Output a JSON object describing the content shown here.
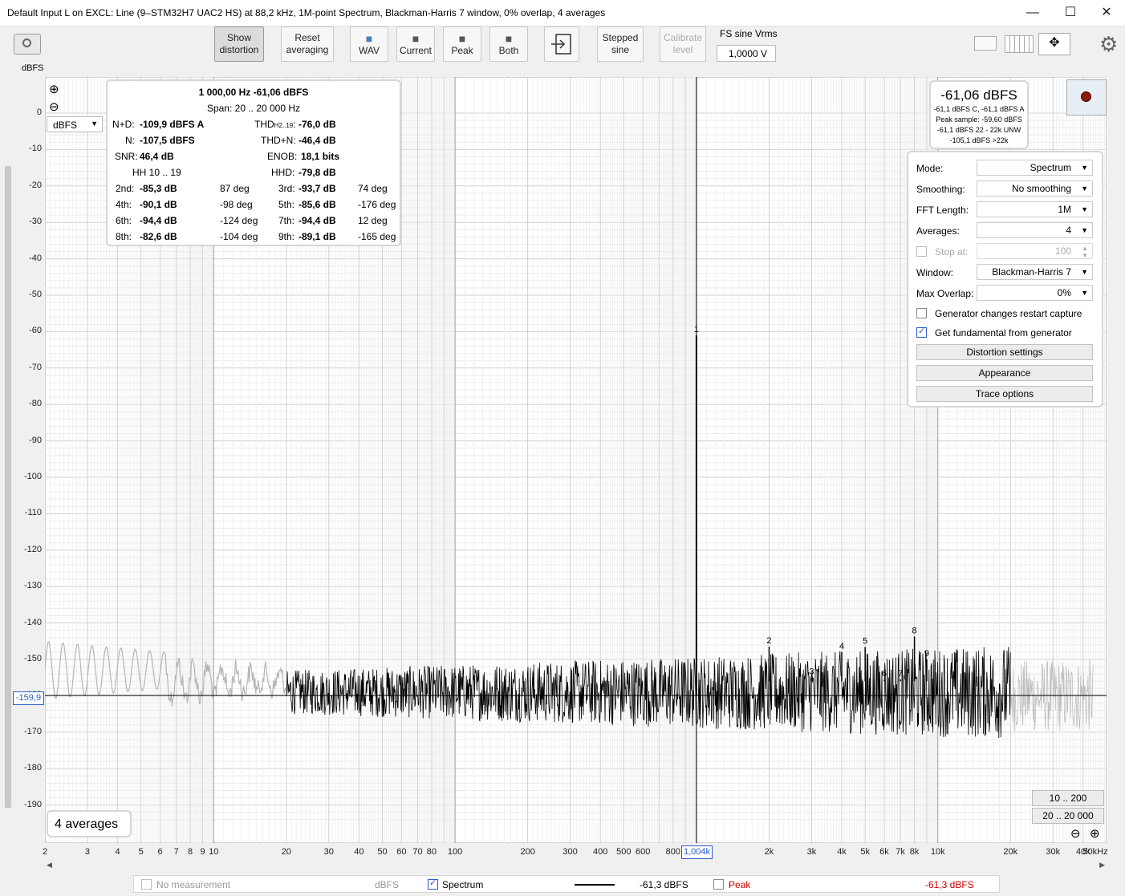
{
  "window": {
    "title": "Default Input L on EXCL: Line (9–STM32H7 UAC2 HS) at 88,2 kHz, 1M-point Spectrum, Blackman-Harris 7 window, 0% overlap, 4 averages",
    "minimize": "—",
    "maximize": "☐",
    "close": "✕"
  },
  "toolbar": {
    "show_distortion": [
      "Show",
      "distortion"
    ],
    "reset_averaging": [
      "Reset",
      "averaging"
    ],
    "wav": "WAV",
    "current": "Current",
    "peak": "Peak",
    "both": "Both",
    "stepped_sine": [
      "Stepped",
      "sine"
    ],
    "calibrate_level": [
      "Calibrate",
      "level"
    ],
    "fs_sine_label": "FS sine Vrms",
    "fs_sine_value": "1,0000 V"
  },
  "plot": {
    "y_unit": "dBFS",
    "unit_select": "dBFS",
    "cursor_value": "-159,9",
    "cursor_freq": "1,004k",
    "averages_badge": "4 averages",
    "range_btn_1": "10 .. 200",
    "range_btn_2": "20 .. 20 000",
    "zoom_in": "⊕",
    "zoom_out": "⊖"
  },
  "stats": {
    "header": "1 000,00 Hz  -61,06 dBFS",
    "span": "Span: 20 .. 20 000 Hz",
    "nd_label": "N+D:",
    "nd_value": "-109,9 dBFS A",
    "thd_label": "THD",
    "thd_sub": "H2..19",
    "thd_value": "-76,0 dB",
    "n_label": "N:",
    "n_value": "-107,5 dBFS",
    "thdn_label": "THD+N:",
    "thdn_value": "-46,4 dB",
    "snr_label": "SNR:",
    "snr_value": "46,4 dB",
    "enob_label": "ENOB:",
    "enob_value": "18,1 bits",
    "hh_label": "HH 10 .. 19",
    "hhd_label": "HHD:",
    "hhd_value": "-79,8 dB",
    "harmonics": [
      {
        "l1": "2nd:",
        "v1": "-85,3 dB",
        "p1": "87 deg",
        "l2": "3rd:",
        "v2": "-93,7 dB",
        "p2": "74 deg"
      },
      {
        "l1": "4th:",
        "v1": "-90,1 dB",
        "p1": "-98 deg",
        "l2": "5th:",
        "v2": "-85,6 dB",
        "p2": "-176 deg"
      },
      {
        "l1": "6th:",
        "v1": "-94,4 dB",
        "p1": "-124 deg",
        "l2": "7th:",
        "v2": "-94,4 dB",
        "p2": "12 deg"
      },
      {
        "l1": "8th:",
        "v1": "-82,6 dB",
        "p1": "-104 deg",
        "l2": "9th:",
        "v2": "-89,1 dB",
        "p2": "-165 deg"
      }
    ]
  },
  "level_box": {
    "main": "-61,06 dBFS",
    "line1": "-61,1 dBFS C, -61,1 dBFS A",
    "line2": "Peak sample: -59,60 dBFS",
    "line3": "-61,1 dBFS 22 - 22k UNW",
    "line4": "-105,1 dBFS >22k"
  },
  "controls": {
    "mode_label": "Mode:",
    "mode_value": "Spectrum",
    "smoothing_label": "Smoothing:",
    "smoothing_value": "No smoothing",
    "fft_label": "FFT Length:",
    "fft_value": "1M",
    "averages_label": "Averages:",
    "averages_value": "4",
    "stop_label": "Stop at:",
    "stop_value": "100",
    "window_label": "Window:",
    "window_value": "Blackman-Harris 7",
    "overlap_label": "Max Overlap:",
    "overlap_value": "0%",
    "gen_restart": "Generator changes restart capture",
    "gen_fundamental": "Get fundamental from generator",
    "distortion_settings": "Distortion settings",
    "appearance": "Appearance",
    "trace_options": "Trace options"
  },
  "status": {
    "no_measurement": "No measurement",
    "no_meas_unit": "dBFS",
    "spectrum": "Spectrum",
    "spectrum_value": "-61,3 dBFS",
    "peak": "Peak",
    "peak_value": "-61,3 dBFS"
  },
  "chart_data": {
    "type": "line",
    "ylabel": "dBFS",
    "xscale": "log",
    "ylim": [
      -195,
      0
    ],
    "xlim": [
      2,
      50000
    ],
    "y_ticks": [
      "0",
      "-10",
      "-20",
      "-30",
      "-40",
      "-50",
      "-60",
      "-70",
      "-80",
      "-90",
      "-100",
      "-110",
      "-120",
      "-130",
      "-140",
      "-150",
      "-160",
      "-170",
      "-180",
      "-190"
    ],
    "x_ticks": [
      {
        "v": 2,
        "t": "2"
      },
      {
        "v": 3,
        "t": "3"
      },
      {
        "v": 4,
        "t": "4"
      },
      {
        "v": 5,
        "t": "5"
      },
      {
        "v": 6,
        "t": "6"
      },
      {
        "v": 7,
        "t": "7"
      },
      {
        "v": 8,
        "t": "8"
      },
      {
        "v": 9,
        "t": "9"
      },
      {
        "v": 10,
        "t": "10"
      },
      {
        "v": 20,
        "t": "20"
      },
      {
        "v": 30,
        "t": "30"
      },
      {
        "v": 40,
        "t": "40"
      },
      {
        "v": 50,
        "t": "50"
      },
      {
        "v": 60,
        "t": "60"
      },
      {
        "v": 70,
        "t": "70"
      },
      {
        "v": 80,
        "t": "80"
      },
      {
        "v": 100,
        "t": "100"
      },
      {
        "v": 200,
        "t": "200"
      },
      {
        "v": 300,
        "t": "300"
      },
      {
        "v": 400,
        "t": "400"
      },
      {
        "v": 500,
        "t": "500"
      },
      {
        "v": 600,
        "t": "600"
      },
      {
        "v": 800,
        "t": "800"
      },
      {
        "v": 2000,
        "t": "2k"
      },
      {
        "v": 3000,
        "t": "3k"
      },
      {
        "v": 4000,
        "t": "4k"
      },
      {
        "v": 5000,
        "t": "5k"
      },
      {
        "v": 6000,
        "t": "6k"
      },
      {
        "v": 7000,
        "t": "7k"
      },
      {
        "v": 8000,
        "t": "8k"
      },
      {
        "v": 10000,
        "t": "10k"
      },
      {
        "v": 20000,
        "t": "20k"
      },
      {
        "v": 30000,
        "t": "30k"
      },
      {
        "v": 40000,
        "t": "40k"
      },
      {
        "v": 50000,
        "t": "50kHz"
      }
    ],
    "cursor_db": -159.9,
    "fundamental": {
      "freq": 1000,
      "db": -61.06
    },
    "noise_floor_db": -160,
    "harmonics": [
      {
        "n": "1",
        "freq": 1000,
        "db": -61
      },
      {
        "n": "2",
        "freq": 2000,
        "db": -146.5
      },
      {
        "n": "3",
        "freq": 3000,
        "db": -155
      },
      {
        "n": "4",
        "freq": 4000,
        "db": -148
      },
      {
        "n": "5",
        "freq": 5000,
        "db": -146.6
      },
      {
        "n": "6",
        "freq": 6000,
        "db": -155.5
      },
      {
        "n": "7",
        "freq": 7000,
        "db": -155.5
      },
      {
        "n": "8",
        "freq": 8000,
        "db": -143.7
      },
      {
        "n": "9",
        "freq": 9000,
        "db": -150
      }
    ],
    "series": [
      {
        "name": "Spectrum",
        "color": "#000000"
      }
    ]
  }
}
